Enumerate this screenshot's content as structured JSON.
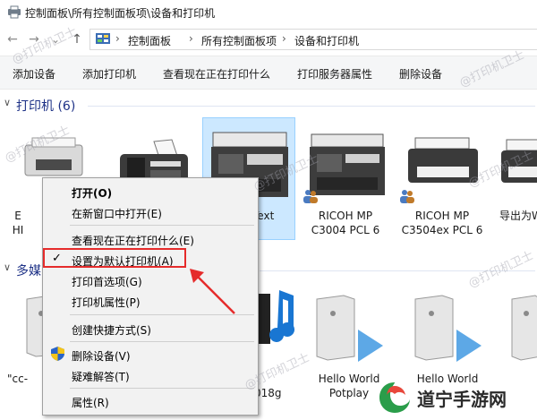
{
  "window": {
    "title": "控制面板\\所有控制面板项\\设备和打印机"
  },
  "address": {
    "nav_back": "←",
    "nav_forward": "→",
    "nav_down": "⌄",
    "nav_up": "↑",
    "crumbs": [
      "控制面板",
      "所有控制面板项",
      "设备和打印机"
    ],
    "separator": "›"
  },
  "commands": [
    "添加设备",
    "添加打印机",
    "查看现在正在打印什么",
    "打印服务器属性",
    "删除设备"
  ],
  "groups": {
    "printers": {
      "chevron": "∨",
      "title": "打印机 (6)"
    },
    "media": {
      "chevron": "∨",
      "title": "多媒"
    }
  },
  "printers": [
    {
      "line1": "E",
      "line2": "HI"
    },
    {
      "line1": "",
      "line2": ""
    },
    {
      "line1": "Text",
      "line2": ""
    },
    {
      "line1": "RICOH MP",
      "line2": "C3004 PCL 6"
    },
    {
      "line1": "RICOH MP",
      "line2": "C3504ex PCL 6"
    },
    {
      "line1": "导出为W",
      "line2": ""
    }
  ],
  "media_devices": [
    {
      "line1": "\"cc-",
      "line2": ""
    },
    {
      "line1": "018g",
      "line2": ""
    },
    {
      "line1": "Hello World",
      "line2": "Potplay"
    },
    {
      "line1": "Hello World",
      "line2": ""
    },
    {
      "line1": "",
      "line2": ""
    }
  ],
  "context_menu": {
    "items": [
      {
        "label": "打开(O)",
        "bold": true
      },
      {
        "label": "在新窗口中打开(E)"
      },
      {
        "label": "查看现在正在打印什么(E)"
      },
      {
        "label": "设置为默认打印机(A)",
        "checked": true
      },
      {
        "label": "打印首选项(G)"
      },
      {
        "label": "打印机属性(P)"
      },
      {
        "label": "创建快捷方式(S)"
      },
      {
        "label": "删除设备(V)",
        "shield": true
      },
      {
        "label": "疑难解答(T)"
      },
      {
        "label": "属性(R)"
      }
    ],
    "check_glyph": "✓"
  },
  "watermark": "@打印机卫士",
  "brand": {
    "name": "道宁手游网"
  },
  "colors": {
    "accent": "#1e3287",
    "selection": "#cce8ff",
    "highlight_red": "#e52b2b"
  }
}
